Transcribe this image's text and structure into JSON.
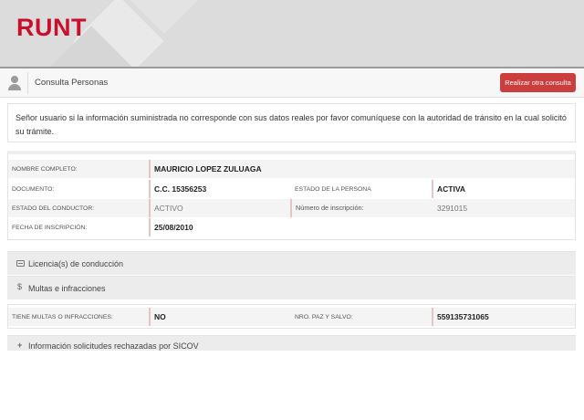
{
  "header": {
    "logo_text": "RUNT",
    "brand_color": "#c8102e"
  },
  "toolbar": {
    "icon": "user-icon",
    "title": "Consulta Personas",
    "button_label": "Realizar otra consulta",
    "button_color": "#cc3d3d"
  },
  "notice": {
    "text": "Señor usuario si la información suministrada no corresponde con sus datos reales por favor comuníquese con la autoridad de tránsito en la cual solicitó su trámite."
  },
  "persona": {
    "nombre_label": "NOMBRE COMPLETO:",
    "nombre_value": "MAURICIO LOPEZ ZULUAGA",
    "documento_label": "DOCUMENTO:",
    "documento_value": "C.C. 15356253",
    "estado_persona_label": "ESTADO DE LA PERSONA",
    "estado_persona_value": "ACTIVA",
    "estado_conductor_label": "ESTADO DEL CONDUCTOR:",
    "estado_conductor_value": "ACTIVO",
    "numero_inscripcion_label": "Número de inscripción:",
    "numero_inscripcion_value": "3291015",
    "fecha_inscripcion_label": "FECHA DE INSCRIPCIÓN:",
    "fecha_inscripcion_value": "25/08/2010"
  },
  "sections": {
    "licencias": {
      "icon": "card-icon",
      "label": "Licencia(s) de conducción"
    },
    "multas": {
      "icon": "dollar-icon",
      "label": "Multas e infracciones"
    },
    "sicov": {
      "icon": "plus-icon",
      "label": "Información solicitudes rechazadas por SICOV"
    }
  },
  "multas": {
    "tiene_label": "TIENE MULTAS O INFRACCIONES:",
    "tiene_value": "NO",
    "paz_label": "NRO. PAZ Y SALVO:",
    "paz_value": "559135731065"
  }
}
